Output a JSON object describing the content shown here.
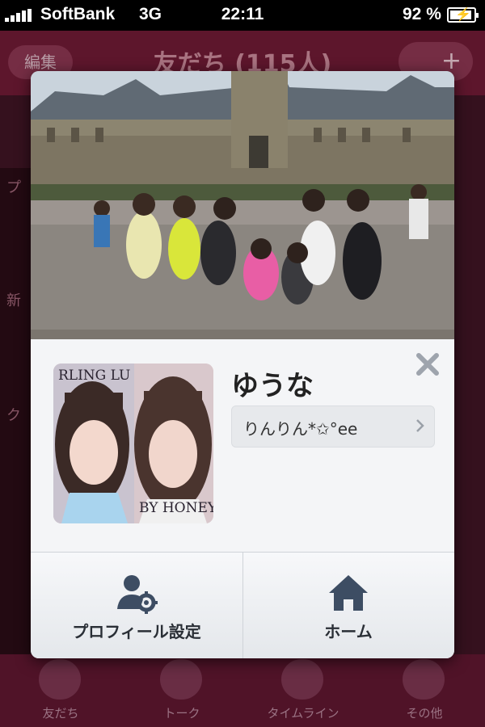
{
  "status_bar": {
    "carrier": "SoftBank",
    "network": "3G",
    "time": "22:11",
    "battery": "92 %",
    "battery_level": 0.92
  },
  "background_app": {
    "edit_label": "編集",
    "title": "友だち (115人)",
    "add_label": "+",
    "side_labels": [
      "プ",
      "新",
      "ク"
    ],
    "tabs": [
      "友だち",
      "トーク",
      "タイムライン",
      "その他"
    ]
  },
  "profile": {
    "name": "ゆうな",
    "status_message": "りんりん*✩°ee",
    "avatar_text_top": "RLING LU",
    "avatar_text_bottom": "BY HONEY"
  },
  "actions": {
    "profile_settings": "プロフィール設定",
    "home": "ホーム"
  },
  "colors": {
    "header": "#6e1b34",
    "card_bg": "#f4f5f7",
    "icon": "#3d4d63"
  }
}
